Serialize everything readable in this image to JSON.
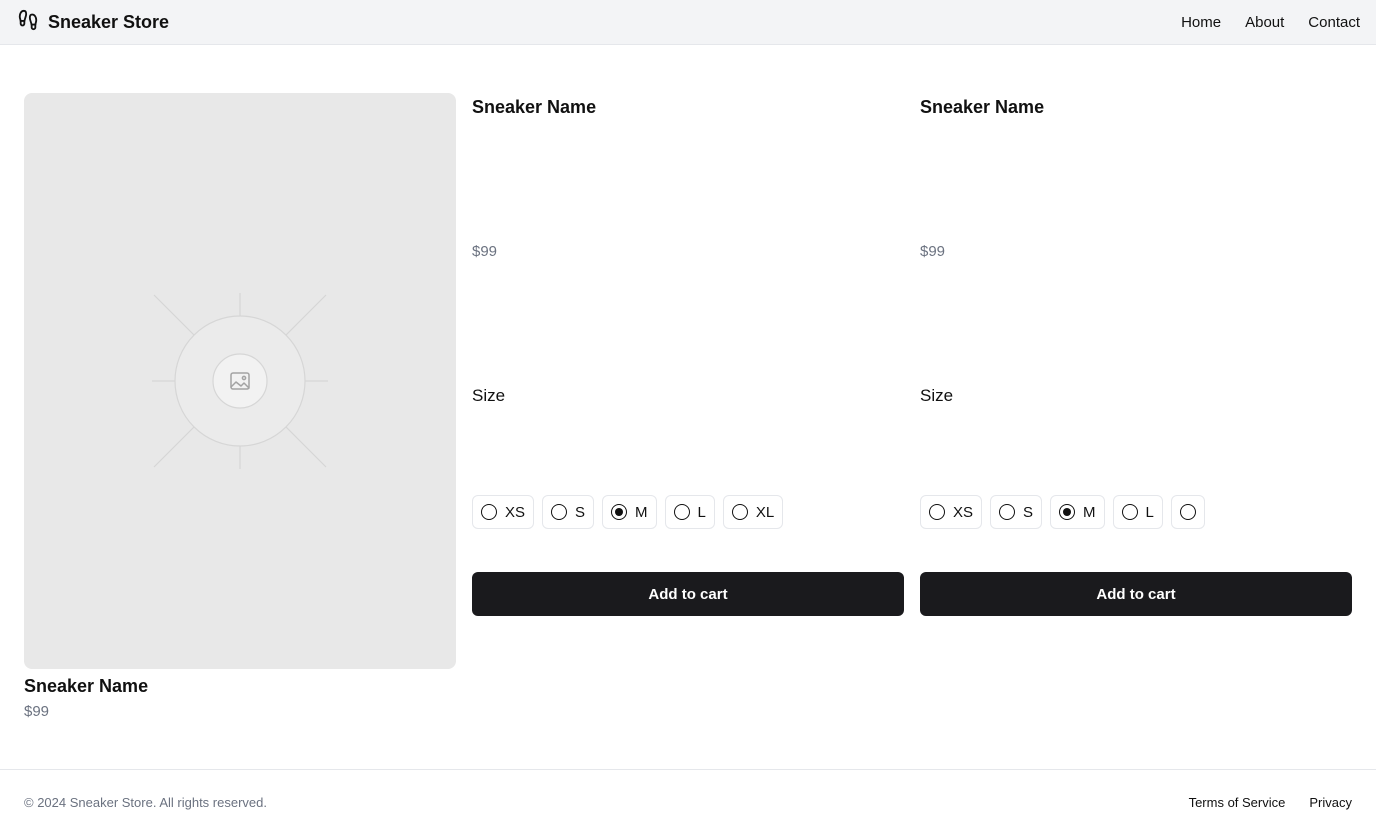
{
  "header": {
    "brand_icon": "footprints-icon",
    "brand_name": "Sneaker Store",
    "nav": [
      "Home",
      "About",
      "Contact"
    ]
  },
  "featured": {
    "image_icon": "image-placeholder-icon",
    "name": "Sneaker Name",
    "price": "$99"
  },
  "products": [
    {
      "name": "Sneaker Name",
      "price": "$99",
      "size_label": "Size",
      "sizes": [
        "XS",
        "S",
        "M",
        "L",
        "XL"
      ],
      "selected_size": "M",
      "button": "Add to cart"
    },
    {
      "name": "Sneaker Name",
      "price": "$99",
      "size_label": "Size",
      "sizes": [
        "XS",
        "S",
        "M",
        "L",
        ""
      ],
      "selected_size": "M",
      "button": "Add to cart"
    }
  ],
  "footer": {
    "copyright": "© 2024 Sneaker Store. All rights reserved.",
    "links": [
      "Terms of Service",
      "Privacy"
    ]
  },
  "colors": {
    "header_bg": "#f3f4f6",
    "button_bg": "#1a1a1d",
    "muted_text": "#6b7280",
    "image_bg": "#e8e8e8"
  }
}
